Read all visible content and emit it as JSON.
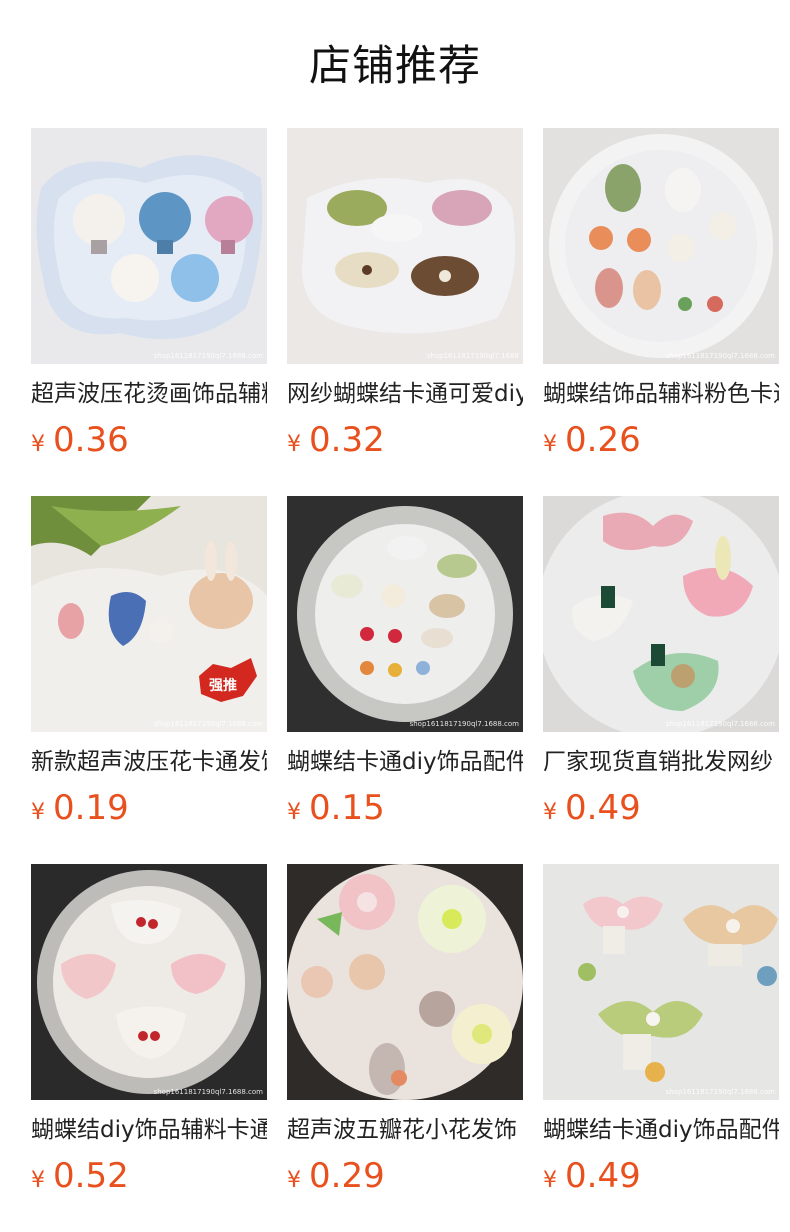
{
  "page": {
    "title": "店铺推荐"
  },
  "colors": {
    "price": "#e8501e",
    "title": "#111111",
    "text": "#222222"
  },
  "products": [
    {
      "name": "超声波压花烫画饰品辅料",
      "currency": "¥",
      "price": "0.36",
      "watermark": "shop1611817190ql7.1688.com"
    },
    {
      "name": "网纱蝴蝶结卡通可爱diy",
      "currency": "¥",
      "price": "0.32",
      "watermark": "shop1611817190ql7.1688"
    },
    {
      "name": "蝴蝶结饰品辅料粉色卡通",
      "currency": "¥",
      "price": "0.26",
      "watermark": "shop1611817190ql7.1688.com"
    },
    {
      "name": "新款超声波压花卡通发饰",
      "currency": "¥",
      "price": "0.19",
      "watermark": "shop1611817190ql7.1688.com",
      "badge": "强推"
    },
    {
      "name": "蝴蝶结卡通diy饰品配件",
      "currency": "¥",
      "price": "0.15",
      "watermark": "shop1611817190ql7.1688.com"
    },
    {
      "name": "厂家现货直销批发网纱",
      "currency": "¥",
      "price": "0.49",
      "watermark": "shop1611817190ql7.1688.com"
    },
    {
      "name": "蝴蝶结diy饰品辅料卡通",
      "currency": "¥",
      "price": "0.52",
      "watermark": "shop1611817190ql7.1688.com"
    },
    {
      "name": "超声波五瓣花小花发饰",
      "currency": "¥",
      "price": "0.29",
      "watermark": ""
    },
    {
      "name": "蝴蝶结卡通diy饰品配件",
      "currency": "¥",
      "price": "0.49",
      "watermark": "shop1611817190ql7.1688.com"
    }
  ]
}
